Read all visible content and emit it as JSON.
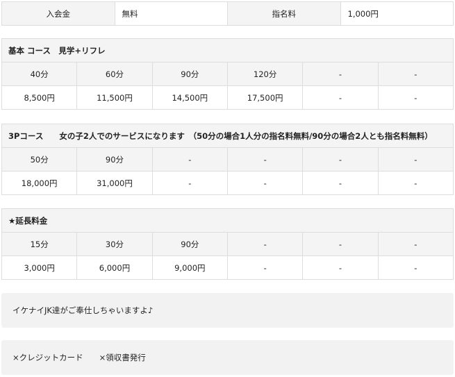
{
  "fees": {
    "entry_label": "入会金",
    "entry_value": "無料",
    "nomination_label": "指名料",
    "nomination_value": "1,000円"
  },
  "tables": [
    {
      "title": "基本 コース　見学+リフレ",
      "durations": [
        "40分",
        "60分",
        "90分",
        "120分",
        "-",
        "-"
      ],
      "prices": [
        "8,500円",
        "11,500円",
        "14,500円",
        "17,500円",
        "-",
        "-"
      ]
    },
    {
      "title": "3Pコース　　女の子2人でのサービスになります　（50分の場合1人分の指名料無料/90分の場合2人とも指名料無料）",
      "durations": [
        "50分",
        "90分",
        "-",
        "-",
        "-",
        "-"
      ],
      "prices": [
        "18,000円",
        "31,000円",
        "-",
        "-",
        "-",
        "-"
      ]
    },
    {
      "title": "★延長料金",
      "durations": [
        "15分",
        "30分",
        "90分",
        "-",
        "-",
        "-"
      ],
      "prices": [
        "3,000円",
        "6,000円",
        "9,000円",
        "-",
        "-",
        "-"
      ]
    }
  ],
  "notes": [
    "イケナイJK達がご奉仕しちゃいますよ♪",
    "×クレジットカード　　×領収書発行"
  ]
}
